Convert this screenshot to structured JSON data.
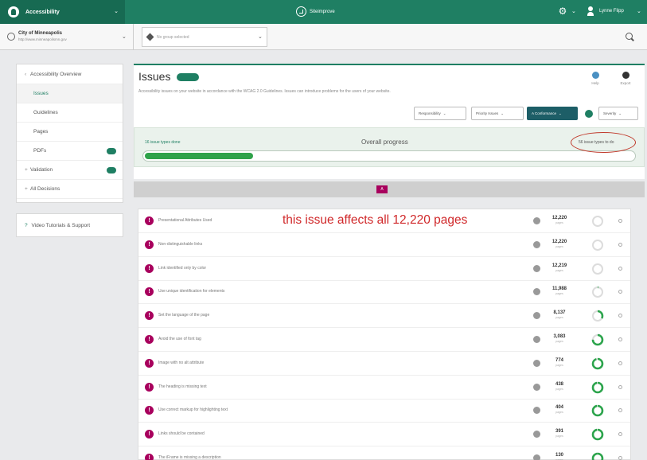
{
  "topbar": {
    "product": "Accessibility",
    "center_brand": "Siteimprove",
    "user_name": "Lynne Flipp"
  },
  "subbar": {
    "site_name": "City of Minneapolis",
    "site_url": "http://www.minneapolismn.gov",
    "group_placeholder": "No group selected"
  },
  "sidebar": {
    "items": [
      {
        "pre": "‹",
        "label": "Accessibility Overview"
      },
      {
        "pre": "",
        "label": "Issues"
      },
      {
        "pre": "",
        "label": "Guidelines"
      },
      {
        "pre": "",
        "label": "Pages"
      },
      {
        "pre": "",
        "label": "PDFs"
      },
      {
        "pre": "+",
        "label": "Validation"
      },
      {
        "pre": "+",
        "label": "All Decisions"
      }
    ],
    "support": {
      "pre": "?",
      "label": "Video Tutorials & Support"
    }
  },
  "main": {
    "title": "Issues",
    "subtitle": "Accessibility issues on your website in accordance with the WCAG 2.0 Guidelines. Issues can introduce problems for the users of your website.",
    "help_label": "Help",
    "export_label": "Export",
    "filters": [
      {
        "label": "Responsibility",
        "on": false
      },
      {
        "label": "Priority Issues",
        "on": false
      },
      {
        "label": "A Conformance",
        "on": true
      },
      {
        "label": "Severity",
        "on": false
      }
    ]
  },
  "progress": {
    "left": "16 issue types done",
    "center": "Overall progress",
    "right": "56 issue types to do",
    "fraction": 0.22
  },
  "letter": "A",
  "annotation": "this issue affects all 12,220 pages",
  "colors": {
    "brand": "#1f7f63",
    "issue": "#a8005d",
    "progress": "#2fa24a",
    "ring": "#2ca44c",
    "annotation": "#d0282a"
  },
  "pages_label": "pages",
  "issues": [
    {
      "label": "Presentational Attributes Used",
      "count": "12,220",
      "fixed": 0
    },
    {
      "label": "Non-distinguishable links",
      "count": "12,220",
      "fixed": 0
    },
    {
      "label": "Link identified only by color",
      "count": "12,219",
      "fixed": 0
    },
    {
      "label": "Use unique identification for elements",
      "count": "11,988",
      "fixed": 0.02
    },
    {
      "label": "Set the language of the page",
      "count": "8,137",
      "fixed": 0.33
    },
    {
      "label": "Avoid the use of font tag",
      "count": "3,083",
      "fixed": 0.75
    },
    {
      "label": "Image with no alt attribute",
      "count": "774",
      "fixed": 0.95
    },
    {
      "label": "The heading is missing text",
      "count": "438",
      "fixed": 0.97
    },
    {
      "label": "Use correct markup for highlighting text",
      "count": "404",
      "fixed": 0.97
    },
    {
      "label": "Links should be contained",
      "count": "391",
      "fixed": 0.97
    },
    {
      "label": "The iFrame is missing a description",
      "count": "130",
      "fixed": 0.99
    }
  ]
}
